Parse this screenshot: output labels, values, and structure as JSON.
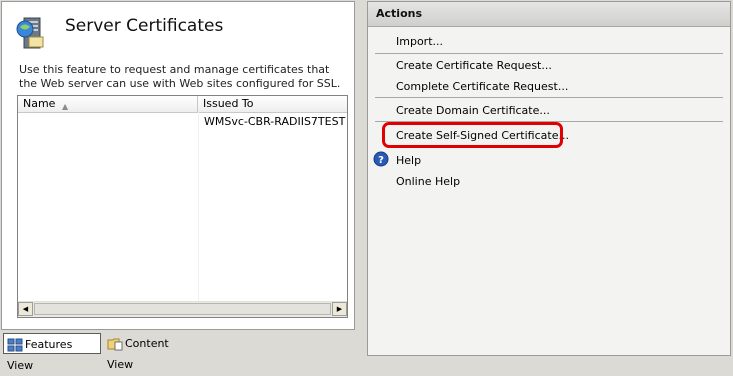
{
  "left_pane": {
    "title": "Server Certificates",
    "description": "Use this feature to request and manage certificates that the Web server can use with Web sites configured for SSL.",
    "columns": [
      "Name",
      "Issued To"
    ],
    "rows": [
      {
        "name": "",
        "issued_to": "WMSvc-CBR-RADIIS7TEST"
      }
    ],
    "sort_indicator": "▲"
  },
  "view_tabs": {
    "features_view": "Features View",
    "content_view": "Content View"
  },
  "actions": {
    "header": "Actions",
    "import": "Import...",
    "create_request": "Create Certificate Request...",
    "complete_request": "Complete Certificate Request...",
    "create_domain": "Create Domain Certificate...",
    "create_self_signed": "Create Self-Signed Certificate...",
    "help": "Help",
    "online_help": "Online Help"
  },
  "colors": {
    "highlight": "#e00000",
    "help_icon": "#2a5ab8"
  },
  "icons": {
    "header": "server-certificates-icon",
    "features_view": "features-view-icon",
    "content_view": "content-view-icon",
    "help": "help-icon"
  }
}
